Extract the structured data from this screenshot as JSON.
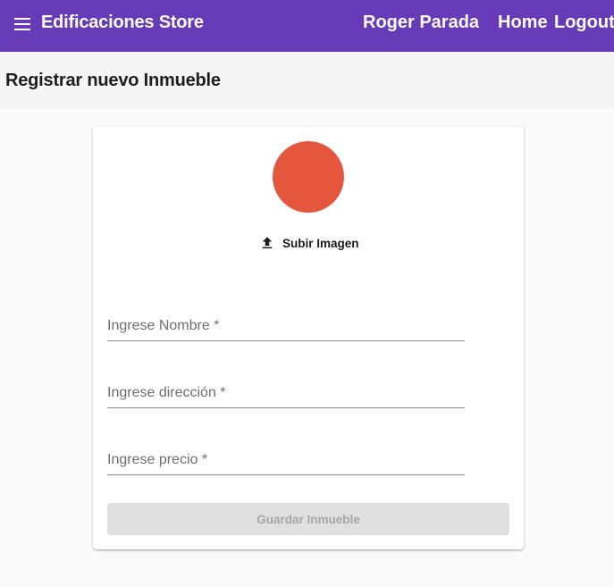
{
  "appbar": {
    "brand": "Edificaciones Store",
    "user": "Roger Parada",
    "nav": {
      "home": "Home",
      "logout": "Logout"
    }
  },
  "page": {
    "title": "Registrar nuevo Inmueble"
  },
  "form": {
    "upload_label": "Subir Imagen",
    "fields": [
      {
        "label": "Ingrese Nombre *",
        "value": ""
      },
      {
        "label": "Ingrese dirección *",
        "value": ""
      },
      {
        "label": "Ingrese precio *",
        "value": ""
      }
    ],
    "submit_label": "Guardar Inmueble",
    "submit_disabled": true
  },
  "colors": {
    "primary": "#673ab7",
    "avatar": "#e4573d",
    "disabled_button": "#e0e0e0"
  },
  "icons": [
    "menu-icon",
    "upload-icon"
  ]
}
